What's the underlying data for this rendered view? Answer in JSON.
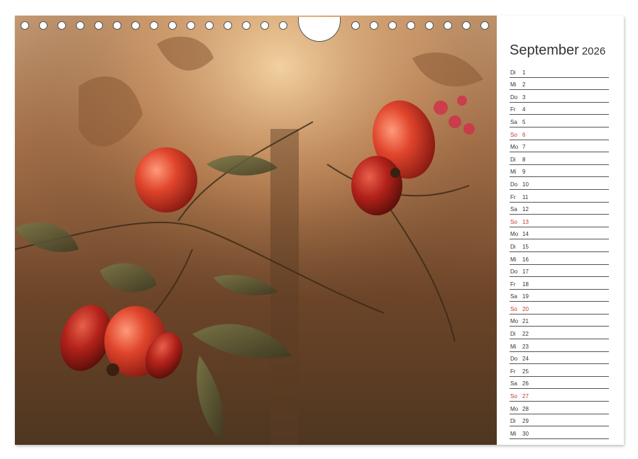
{
  "calendar": {
    "month": "September",
    "year": "2026",
    "colors": {
      "sunday": "#c0392b",
      "text": "#333333",
      "line": "#555555"
    },
    "days": [
      {
        "weekday": "Di",
        "day": "1"
      },
      {
        "weekday": "Mi",
        "day": "2"
      },
      {
        "weekday": "Do",
        "day": "3"
      },
      {
        "weekday": "Fr",
        "day": "4"
      },
      {
        "weekday": "Sa",
        "day": "5"
      },
      {
        "weekday": "So",
        "day": "6",
        "sunday": true
      },
      {
        "weekday": "Mo",
        "day": "7"
      },
      {
        "weekday": "Di",
        "day": "8"
      },
      {
        "weekday": "Mi",
        "day": "9"
      },
      {
        "weekday": "Do",
        "day": "10"
      },
      {
        "weekday": "Fr",
        "day": "11"
      },
      {
        "weekday": "Sa",
        "day": "12"
      },
      {
        "weekday": "So",
        "day": "13",
        "sunday": true
      },
      {
        "weekday": "Mo",
        "day": "14"
      },
      {
        "weekday": "Di",
        "day": "15"
      },
      {
        "weekday": "Mi",
        "day": "16"
      },
      {
        "weekday": "Do",
        "day": "17"
      },
      {
        "weekday": "Fr",
        "day": "18"
      },
      {
        "weekday": "Sa",
        "day": "19"
      },
      {
        "weekday": "So",
        "day": "20",
        "sunday": true
      },
      {
        "weekday": "Mo",
        "day": "21"
      },
      {
        "weekday": "Di",
        "day": "22"
      },
      {
        "weekday": "Mi",
        "day": "23"
      },
      {
        "weekday": "Do",
        "day": "24"
      },
      {
        "weekday": "Fr",
        "day": "25"
      },
      {
        "weekday": "Sa",
        "day": "26"
      },
      {
        "weekday": "So",
        "day": "27",
        "sunday": true
      },
      {
        "weekday": "Mo",
        "day": "28"
      },
      {
        "weekday": "Di",
        "day": "29"
      },
      {
        "weekday": "Mi",
        "day": "30"
      }
    ]
  }
}
